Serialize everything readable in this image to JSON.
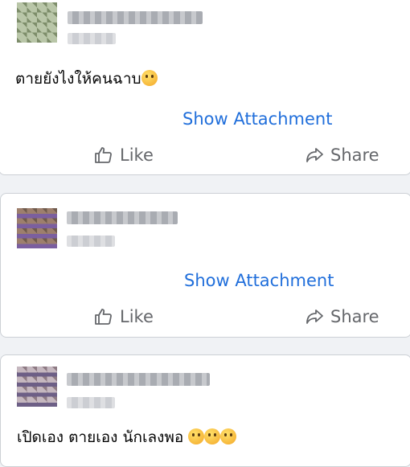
{
  "posts": [
    {
      "message": "ตายยังไงให้คนฉาบ",
      "emojis": [
        "thinking-face"
      ],
      "attachment_label": "Show Attachment",
      "like_label": "Like",
      "share_label": "Share",
      "avatar_colors": [
        "#b9c6a8",
        "#7d8d6a",
        "#c9d3b7",
        "#a0ad8a"
      ]
    },
    {
      "message": "",
      "emojis": [],
      "attachment_label": "Show Attachment",
      "like_label": "Like",
      "share_label": "Share",
      "avatar_colors": [
        "#6f5a4c",
        "#9d7f6d",
        "#7b5f9f",
        "#b8a9c4"
      ]
    },
    {
      "message": "เปิดเอง ตายเอง นักเลงพอ",
      "emojis": [
        "face-with-rolling-eyes",
        "unamused-face",
        "smirking-face"
      ],
      "attachment_label": "",
      "like_label": "",
      "share_label": "",
      "avatar_colors": [
        "#8d7a83",
        "#5c4a61",
        "#c5b7bf",
        "#6d5f86"
      ]
    }
  ],
  "colors": {
    "link": "#216fdb",
    "action_text": "#65676b",
    "card_border": "#ccd0d5",
    "background": "#f0f2f5"
  }
}
